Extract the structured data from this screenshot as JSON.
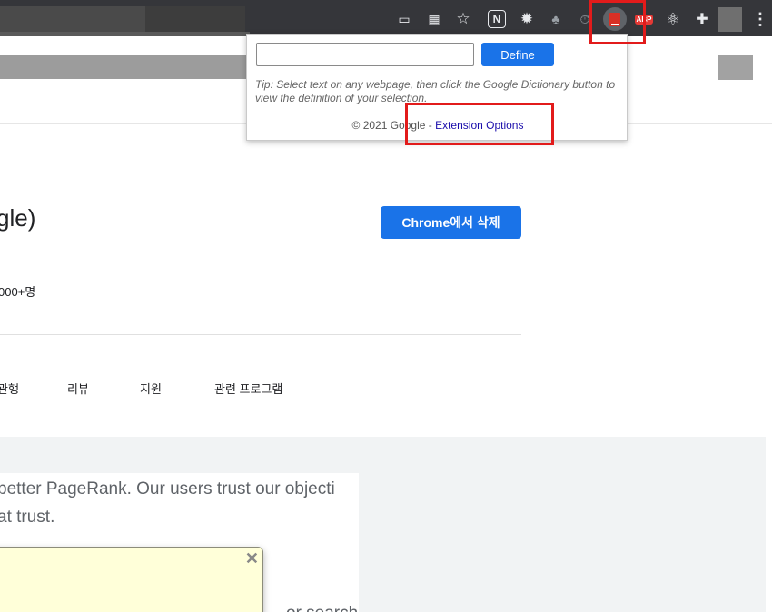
{
  "browser": {
    "extensions": [
      {
        "icon": "cast-icon",
        "glyph": "▭"
      },
      {
        "icon": "grid-extension-icon",
        "glyph": "▦"
      },
      {
        "icon": "bookmark-star-icon",
        "glyph": "☆"
      },
      {
        "icon": "notion-icon",
        "glyph": "N"
      },
      {
        "icon": "gear-extension-icon",
        "glyph": "✹"
      },
      {
        "icon": "spy-extension-icon",
        "glyph": "♣"
      },
      {
        "icon": "timer-icon",
        "glyph": "⏱"
      },
      {
        "icon": "dictionary-extension-icon",
        "glyph": ""
      },
      {
        "icon": "adblock-plus-icon",
        "glyph": "ABP"
      },
      {
        "icon": "react-icon",
        "glyph": "⚛"
      },
      {
        "icon": "puzzle-extensions-icon",
        "glyph": "✚"
      }
    ],
    "menu_glyph": "⋮"
  },
  "dictionary_popup": {
    "input_value": "",
    "define_label": "Define",
    "tip": "Tip: Select text on any webpage, then click the Google Dictionary button to view the definition of your selection.",
    "footer_prefix": "© 2021 Google - ",
    "options_link": "Extension Options"
  },
  "page": {
    "title_fragment": "gle)",
    "remove_button": "Chrome에서 삭제",
    "users": "000+명",
    "tabs": [
      "관행",
      "리뷰",
      "지원",
      "관련 프로그램"
    ],
    "description_lines": [
      "better PageRank. Our users trust our objecti",
      "at trust.",
      "or search a"
    ]
  },
  "note_popup": {
    "close_glyph": "✕"
  },
  "colors": {
    "accent": "#1a73e8",
    "highlight": "#e21b1b",
    "toolbar": "#35363a"
  }
}
